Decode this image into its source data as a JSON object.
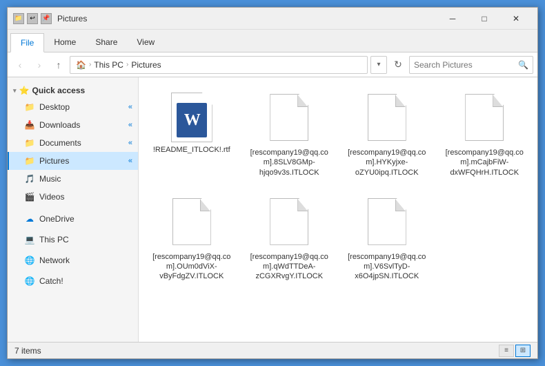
{
  "window": {
    "title": "Pictures",
    "tabs": [
      "File",
      "Home",
      "Share",
      "View"
    ],
    "active_tab": "File"
  },
  "address": {
    "path_parts": [
      "This PC",
      "Pictures"
    ],
    "search_placeholder": "Search Pictures"
  },
  "sidebar": {
    "quick_access_label": "Quick access",
    "items": [
      {
        "id": "desktop",
        "label": "Desktop",
        "icon": "folder"
      },
      {
        "id": "downloads",
        "label": "Downloads",
        "icon": "folder-down"
      },
      {
        "id": "documents",
        "label": "Documents",
        "icon": "folder"
      },
      {
        "id": "pictures",
        "label": "Pictures",
        "icon": "folder",
        "active": true
      },
      {
        "id": "music",
        "label": "Music",
        "icon": "folder"
      },
      {
        "id": "videos",
        "label": "Videos",
        "icon": "folder"
      },
      {
        "id": "onedrive",
        "label": "OneDrive",
        "icon": "cloud"
      },
      {
        "id": "thispc",
        "label": "This PC",
        "icon": "pc"
      },
      {
        "id": "network",
        "label": "Network",
        "icon": "network"
      },
      {
        "id": "catch",
        "label": "Catch!",
        "icon": "globe"
      }
    ]
  },
  "files": [
    {
      "id": "readme",
      "name": "!README_ITLOCK!.rtf",
      "type": "word"
    },
    {
      "id": "file1",
      "name": "[rescompany19@qq.com].8SLV8GMp-hjqo9v3s.ITLOCK",
      "type": "generic"
    },
    {
      "id": "file2",
      "name": "[rescompany19@qq.com].HYKyjxe-oZYU0ipq.ITLOCK",
      "type": "generic"
    },
    {
      "id": "file3",
      "name": "[rescompany19@qq.com].mCajbFiW-dxWFQHrH.ITLOCK",
      "type": "generic"
    },
    {
      "id": "file4",
      "name": "[rescompany19@qq.com].OUm0dViX-vByFdgZV.ITLOCK",
      "type": "generic"
    },
    {
      "id": "file5",
      "name": "[rescompany19@qq.com].qWdTTDeA-zCGXRvgY.ITLOCK",
      "type": "generic"
    },
    {
      "id": "file6",
      "name": "[rescompany19@qq.com].V6SvlTyD-x6O4jpSN.ITLOCK",
      "type": "generic"
    }
  ],
  "status": {
    "item_count": "7 items"
  }
}
